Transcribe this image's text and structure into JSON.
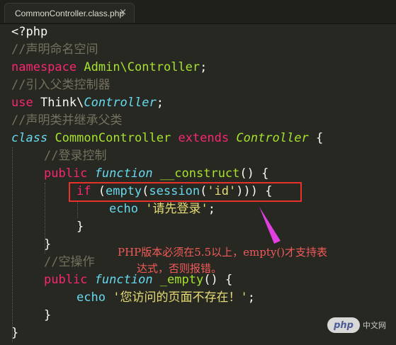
{
  "tab": {
    "title": "CommonController.class.php",
    "close_glyph": "×"
  },
  "code": [
    {
      "indent": 0,
      "tokens": [
        {
          "t": "<?php",
          "c": "pl"
        }
      ]
    },
    {
      "indent": 0,
      "tokens": [
        {
          "t": "//声明命名空间",
          "c": "cmt"
        }
      ]
    },
    {
      "indent": 0,
      "tokens": [
        {
          "t": "namespace",
          "c": "kw"
        },
        {
          "t": " ",
          "c": "pl"
        },
        {
          "t": "Admin\\Controller",
          "c": "ns"
        },
        {
          "t": ";",
          "c": "pl"
        }
      ]
    },
    {
      "indent": 0,
      "tokens": [
        {
          "t": "//引入父类控制器",
          "c": "cmt"
        }
      ]
    },
    {
      "indent": 0,
      "tokens": [
        {
          "t": "use",
          "c": "kw"
        },
        {
          "t": " Think\\",
          "c": "pl"
        },
        {
          "t": "Controller",
          "c": "ital"
        },
        {
          "t": ";",
          "c": "pl"
        }
      ]
    },
    {
      "indent": 0,
      "tokens": [
        {
          "t": "//声明类并继承父类",
          "c": "cmt"
        }
      ]
    },
    {
      "indent": 0,
      "tokens": [
        {
          "t": "class",
          "c": "ital"
        },
        {
          "t": " ",
          "c": "pl"
        },
        {
          "t": "CommonController",
          "c": "cls"
        },
        {
          "t": " ",
          "c": "pl"
        },
        {
          "t": "extends",
          "c": "kw"
        },
        {
          "t": " ",
          "c": "pl"
        },
        {
          "t": "Controller",
          "c": "inh"
        },
        {
          "t": " {",
          "c": "pl"
        }
      ]
    },
    {
      "indent": 1,
      "tokens": [
        {
          "t": "//登录控制",
          "c": "cmt"
        }
      ]
    },
    {
      "indent": 1,
      "tokens": [
        {
          "t": "public",
          "c": "kw"
        },
        {
          "t": " ",
          "c": "pl"
        },
        {
          "t": "function",
          "c": "ital"
        },
        {
          "t": " ",
          "c": "pl"
        },
        {
          "t": "__construct",
          "c": "fn"
        },
        {
          "t": "() {",
          "c": "pl"
        }
      ]
    },
    {
      "indent": 2,
      "tokens": [
        {
          "t": "if",
          "c": "kw"
        },
        {
          "t": " (",
          "c": "pl"
        },
        {
          "t": "empty",
          "c": "bi"
        },
        {
          "t": "(",
          "c": "pl"
        },
        {
          "t": "session",
          "c": "bi"
        },
        {
          "t": "(",
          "c": "pl"
        },
        {
          "t": "'id'",
          "c": "str"
        },
        {
          "t": "))) {",
          "c": "pl"
        }
      ]
    },
    {
      "indent": 3,
      "tokens": [
        {
          "t": "echo",
          "c": "bi"
        },
        {
          "t": " ",
          "c": "pl"
        },
        {
          "t": "'请先登录'",
          "c": "str"
        },
        {
          "t": ";",
          "c": "pl"
        }
      ]
    },
    {
      "indent": 2,
      "tokens": [
        {
          "t": "}",
          "c": "pl"
        }
      ]
    },
    {
      "indent": 1,
      "tokens": [
        {
          "t": "}",
          "c": "pl"
        }
      ]
    },
    {
      "indent": 1,
      "tokens": [
        {
          "t": "//空操作",
          "c": "cmt"
        }
      ]
    },
    {
      "indent": 1,
      "tokens": [
        {
          "t": "public",
          "c": "kw"
        },
        {
          "t": " ",
          "c": "pl"
        },
        {
          "t": "function",
          "c": "ital"
        },
        {
          "t": " ",
          "c": "pl"
        },
        {
          "t": "_empty",
          "c": "fn"
        },
        {
          "t": "() {",
          "c": "pl"
        }
      ]
    },
    {
      "indent": 2,
      "tokens": [
        {
          "t": "echo",
          "c": "bi"
        },
        {
          "t": " ",
          "c": "pl"
        },
        {
          "t": "'您访问的页面不存在！'",
          "c": "str"
        },
        {
          "t": ";",
          "c": "pl"
        }
      ]
    },
    {
      "indent": 1,
      "tokens": [
        {
          "t": "}",
          "c": "pl"
        }
      ]
    },
    {
      "indent": 0,
      "tokens": [
        {
          "t": "}",
          "c": "pl"
        }
      ]
    }
  ],
  "annotation": {
    "line1": "PHP版本必须在5.5以上，empty()才支持表",
    "line2": "达式，否则报错。",
    "box_color": "#e8312a",
    "arrow_color": "#e040e0"
  },
  "watermark": {
    "logo": "php",
    "text": "中文网"
  },
  "colors": {
    "background": "#272822",
    "keyword": "#f92672",
    "function_name": "#a6e22e",
    "builtin": "#66d9ef",
    "string": "#e6db74",
    "comment": "#75715e"
  }
}
